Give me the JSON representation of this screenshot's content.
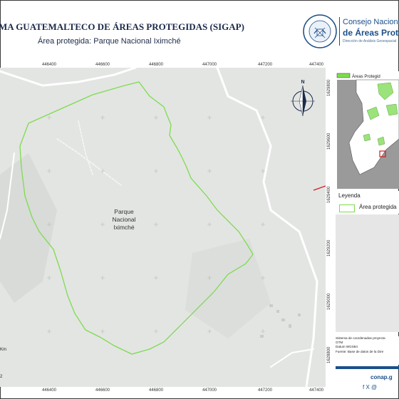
{
  "header": {
    "title": "MA GUATEMALTECO DE ÁREAS PROTEGIDAS  (SIGAP)",
    "subtitle": "Área protegida: Parque Nacional Iximché",
    "seal_text_top": "GOBIERNO DE LA REPÚBLICA DE",
    "seal_text_bottom": "GUATEMALA"
  },
  "org": {
    "line1": "Consejo Nacional",
    "line2": "de Áreas Protegid",
    "line3": "Dirección de Análisis Geoespacial"
  },
  "map": {
    "park_label_line1": "Parque",
    "park_label_line2": "Nacional",
    "park_label_line3": "Iximché",
    "north_label": "N",
    "x_ticks": [
      "446400",
      "446600",
      "446800",
      "447000",
      "447200",
      "447400"
    ],
    "y_ticks": [
      "1629800",
      "1629600",
      "1629400",
      "1629200",
      "1629000",
      "1628800"
    ],
    "boundary_color": "#7ddc4e",
    "base_color": "#e3e5e3"
  },
  "inset": {
    "legend_item": "Áreas Protegid"
  },
  "legend": {
    "title": "Leyenda",
    "item_label": "Área protegida"
  },
  "info": {
    "line1": "Sistema de coordenadas proyecta",
    "line2": "GTM",
    "line3": "Datum WGS84",
    "line4": "Fuente: Base de datos de la Dire"
  },
  "footer": {
    "url": "conap.g",
    "socials": "f  X  @"
  },
  "scale": {
    "unit": "Km",
    "value": "2"
  }
}
